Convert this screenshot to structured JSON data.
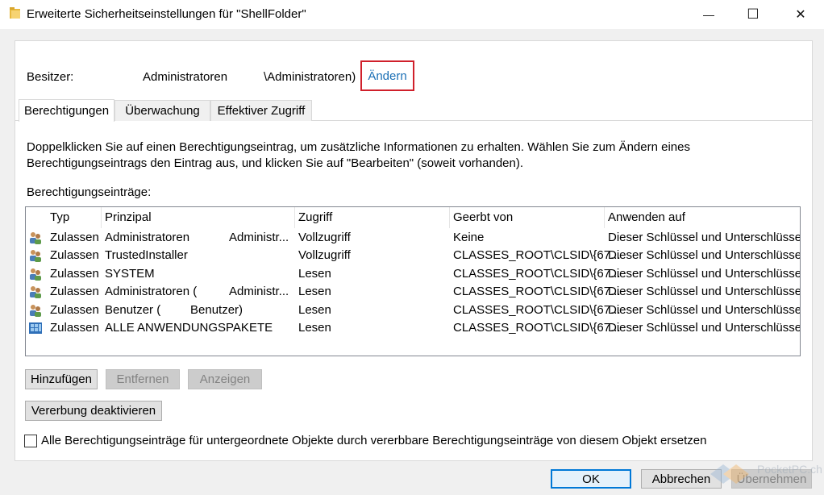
{
  "window": {
    "title": "Erweiterte Sicherheitseinstellungen für \"ShellFolder\"",
    "minimize_glyph": "—",
    "maximize_glyph": "☐",
    "close_glyph": "✕"
  },
  "owner": {
    "label": "Besitzer:",
    "name": "Administratoren",
    "account": "\\Administratoren)",
    "change_link": "Ändern"
  },
  "tabs": [
    {
      "label": "Berechtigungen",
      "active": true
    },
    {
      "label": "Überwachung",
      "active": false
    },
    {
      "label": "Effektiver Zugriff",
      "active": false
    }
  ],
  "instructions": {
    "line1": "Doppelklicken Sie auf einen Berechtigungseintrag, um zusätzliche Informationen zu erhalten. Wählen Sie zum Ändern eines",
    "line2": "Berechtigungseintrags den Eintrag aus, und klicken Sie auf \"Bearbeiten\" (soweit vorhanden)."
  },
  "entries_label": "Berechtigungseinträge:",
  "table": {
    "columns": [
      "Typ",
      "Prinzipal",
      "Zugriff",
      "Geerbt von",
      "Anwenden auf"
    ],
    "rows": [
      {
        "icon": "users-icon",
        "type": "Zulassen",
        "principal_a": "Administratoren",
        "principal_b": "Administr...",
        "access": "Vollzugriff",
        "inherited": "Keine",
        "apply": "Dieser Schlüssel und Unterschlüssel"
      },
      {
        "icon": "users-icon",
        "type": "Zulassen",
        "principal_a": "TrustedInstaller",
        "principal_b": "",
        "access": "Vollzugriff",
        "inherited": "CLASSES_ROOT\\CLSID\\{67...",
        "apply": "Dieser Schlüssel und Unterschlüssel"
      },
      {
        "icon": "users-icon",
        "type": "Zulassen",
        "principal_a": "SYSTEM",
        "principal_b": "",
        "access": "Lesen",
        "inherited": "CLASSES_ROOT\\CLSID\\{67...",
        "apply": "Dieser Schlüssel und Unterschlüssel"
      },
      {
        "icon": "users-icon",
        "type": "Zulassen",
        "principal_a": "Administratoren (",
        "principal_b": "Administr...",
        "access": "Lesen",
        "inherited": "CLASSES_ROOT\\CLSID\\{67...",
        "apply": "Dieser Schlüssel und Unterschlüssel"
      },
      {
        "icon": "users-icon",
        "type": "Zulassen",
        "principal_a": "Benutzer (",
        "principal_b": "Benutzer)",
        "access": "Lesen",
        "inherited": "CLASSES_ROOT\\CLSID\\{67...",
        "apply": "Dieser Schlüssel und Unterschlüssel"
      },
      {
        "icon": "app-packages-icon",
        "type": "Zulassen",
        "principal_a": "ALLE ANWENDUNGSPAKETE",
        "principal_b": "",
        "access": "Lesen",
        "inherited": "CLASSES_ROOT\\CLSID\\{67...",
        "apply": "Dieser Schlüssel und Unterschlüssel"
      }
    ]
  },
  "buttons": {
    "add": "Hinzufügen",
    "remove": "Entfernen",
    "view": "Anzeigen",
    "disable_inheritance": "Vererbung deaktivieren"
  },
  "replace_checkbox": {
    "label": "Alle Berechtigungseinträge für untergeordnete Objekte durch vererbbare Berechtigungseinträge von diesem Objekt ersetzen",
    "checked": false
  },
  "footer": {
    "ok": "OK",
    "cancel": "Abbrechen",
    "apply": "Übernehmen"
  },
  "watermark_text": "PocketPC.ch",
  "colors": {
    "link": "#1a6fb5",
    "highlight_box": "#d0202b",
    "default_button_border": "#0078d7"
  }
}
